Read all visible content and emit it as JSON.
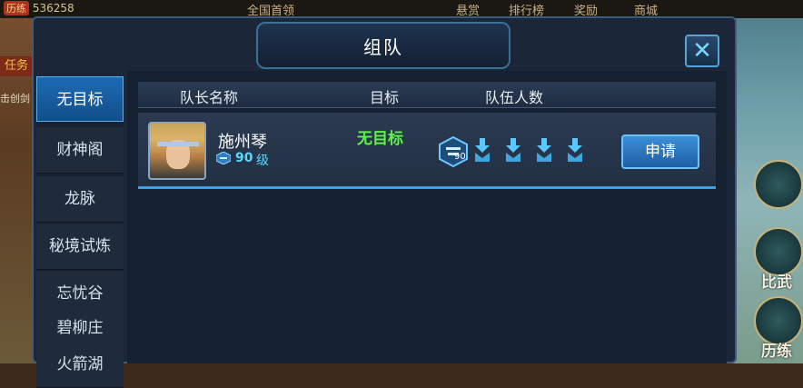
{
  "topbar": {
    "money_seal": "历练",
    "money_value": "536258",
    "links": [
      "全国首领",
      "悬赏",
      "排行榜",
      "奖励",
      "商城"
    ]
  },
  "left_hud": {
    "badge": "任务",
    "text": "击创剑"
  },
  "panel": {
    "title": "组队",
    "close_label": "✕"
  },
  "tabs": [
    {
      "label": "无目标",
      "active": true
    },
    {
      "label": "财神阁",
      "active": false
    },
    {
      "label": "龙脉",
      "active": false
    },
    {
      "label": "秘境试炼",
      "active": false
    },
    {
      "label": "忘忧谷",
      "active": false
    },
    {
      "label": "碧柳庄",
      "active": false
    },
    {
      "label": "火箭湖",
      "active": false
    }
  ],
  "table": {
    "headers": {
      "leader": "队长名称",
      "target": "目标",
      "members": "队伍人数"
    },
    "rows": [
      {
        "leader_name": "施州琴",
        "level": "90",
        "level_unit": "级",
        "target": "无目标",
        "leader_level_badge": "90",
        "empty_slots": 4,
        "action_label": "申请"
      }
    ]
  },
  "right_hud": {
    "labels": [
      "比武",
      "历练"
    ]
  },
  "colors": {
    "accent": "#3da0e0",
    "target_green": "#5ef24a",
    "level_cyan": "#59d8ff"
  }
}
